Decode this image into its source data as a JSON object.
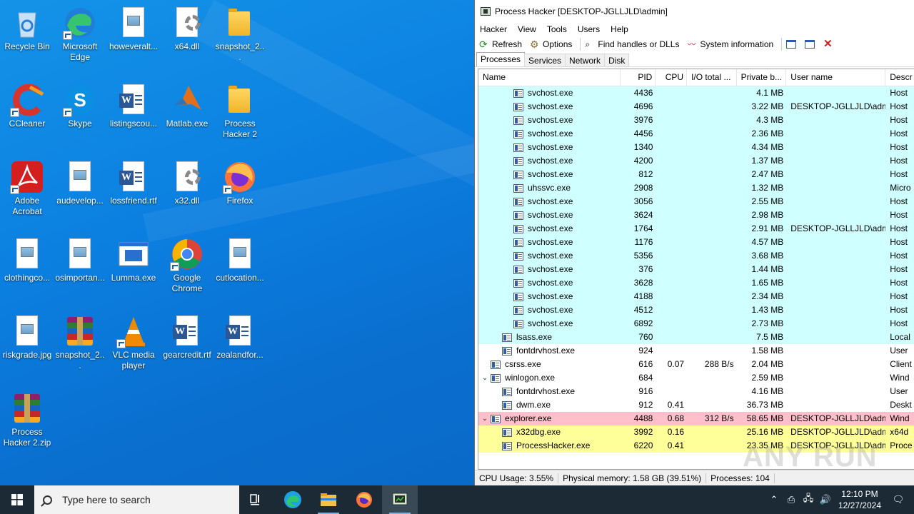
{
  "desktop": {
    "icons": [
      {
        "label": "Recycle Bin",
        "icon": "recycle-bin-icon"
      },
      {
        "label": "Microsoft Edge",
        "icon": "edge-icon"
      },
      {
        "label": "howeveralt...",
        "icon": "image-file-icon"
      },
      {
        "label": "x64.dll",
        "icon": "dll-file-icon"
      },
      {
        "label": "snapshot_2...",
        "icon": "folder-icon"
      },
      {
        "label": "CCleaner",
        "icon": "ccleaner-icon"
      },
      {
        "label": "Skype",
        "icon": "skype-icon"
      },
      {
        "label": "listingscou...",
        "icon": "word-doc-icon"
      },
      {
        "label": "Matlab.exe",
        "icon": "matlab-icon"
      },
      {
        "label": "Process Hacker 2",
        "icon": "folder-icon"
      },
      {
        "label": "Adobe Acrobat",
        "icon": "acrobat-icon"
      },
      {
        "label": "audevelop...",
        "icon": "image-file-icon"
      },
      {
        "label": "lossfriend.rtf",
        "icon": "word-doc-icon"
      },
      {
        "label": "x32.dll",
        "icon": "dll-file-icon"
      },
      {
        "label": "Firefox",
        "icon": "firefox-icon"
      },
      {
        "label": "clothingco...",
        "icon": "image-file-icon"
      },
      {
        "label": "osimportan...",
        "icon": "image-file-icon"
      },
      {
        "label": "Lumma.exe",
        "icon": "exe-window-icon"
      },
      {
        "label": "Google Chrome",
        "icon": "chrome-icon"
      },
      {
        "label": "cutlocation...",
        "icon": "image-file-icon"
      },
      {
        "label": "riskgrade.jpg",
        "icon": "image-file-icon"
      },
      {
        "label": "snapshot_2...",
        "icon": "winrar-icon"
      },
      {
        "label": "VLC media player",
        "icon": "vlc-icon"
      },
      {
        "label": "gearcredit.rtf",
        "icon": "word-doc-icon"
      },
      {
        "label": "zealandfor...",
        "icon": "word-doc-icon"
      },
      {
        "label": "Process Hacker 2.zip",
        "icon": "winrar-icon"
      }
    ]
  },
  "process_hacker": {
    "title": "Process Hacker [DESKTOP-JGLLJLD\\admin]",
    "menu": [
      "Hacker",
      "View",
      "Tools",
      "Users",
      "Help"
    ],
    "toolbar": {
      "refresh": "Refresh",
      "options": "Options",
      "find": "Find handles or DLLs",
      "sysinfo": "System information"
    },
    "tabs": [
      "Processes",
      "Services",
      "Network",
      "Disk"
    ],
    "columns": [
      "Name",
      "PID",
      "CPU",
      "I/O total ...",
      "Private b...",
      "User name",
      "Descr"
    ],
    "rows": [
      {
        "name": "svchost.exe",
        "pid": "4436",
        "cpu": "",
        "io": "",
        "priv": "4.1 MB",
        "user": "",
        "desc": "Host",
        "indent": 3,
        "bg": "#d0ffff",
        "exp": ""
      },
      {
        "name": "svchost.exe",
        "pid": "4696",
        "cpu": "",
        "io": "",
        "priv": "3.22 MB",
        "user": "DESKTOP-JGLLJLD\\admi",
        "desc": "Host",
        "indent": 3,
        "bg": "#d0ffff",
        "exp": ""
      },
      {
        "name": "svchost.exe",
        "pid": "3976",
        "cpu": "",
        "io": "",
        "priv": "4.3 MB",
        "user": "",
        "desc": "Host",
        "indent": 3,
        "bg": "#d0ffff",
        "exp": ""
      },
      {
        "name": "svchost.exe",
        "pid": "4456",
        "cpu": "",
        "io": "",
        "priv": "2.36 MB",
        "user": "",
        "desc": "Host",
        "indent": 3,
        "bg": "#d0ffff",
        "exp": ""
      },
      {
        "name": "svchost.exe",
        "pid": "1340",
        "cpu": "",
        "io": "",
        "priv": "4.34 MB",
        "user": "",
        "desc": "Host",
        "indent": 3,
        "bg": "#d0ffff",
        "exp": ""
      },
      {
        "name": "svchost.exe",
        "pid": "4200",
        "cpu": "",
        "io": "",
        "priv": "1.37 MB",
        "user": "",
        "desc": "Host",
        "indent": 3,
        "bg": "#d0ffff",
        "exp": ""
      },
      {
        "name": "svchost.exe",
        "pid": "812",
        "cpu": "",
        "io": "",
        "priv": "2.47 MB",
        "user": "",
        "desc": "Host",
        "indent": 3,
        "bg": "#d0ffff",
        "exp": ""
      },
      {
        "name": "uhssvc.exe",
        "pid": "2908",
        "cpu": "",
        "io": "",
        "priv": "1.32 MB",
        "user": "",
        "desc": "Micro",
        "indent": 3,
        "bg": "#d0ffff",
        "exp": ""
      },
      {
        "name": "svchost.exe",
        "pid": "3056",
        "cpu": "",
        "io": "",
        "priv": "2.55 MB",
        "user": "",
        "desc": "Host",
        "indent": 3,
        "bg": "#d0ffff",
        "exp": ""
      },
      {
        "name": "svchost.exe",
        "pid": "3624",
        "cpu": "",
        "io": "",
        "priv": "2.98 MB",
        "user": "",
        "desc": "Host",
        "indent": 3,
        "bg": "#d0ffff",
        "exp": ""
      },
      {
        "name": "svchost.exe",
        "pid": "1764",
        "cpu": "",
        "io": "",
        "priv": "2.91 MB",
        "user": "DESKTOP-JGLLJLD\\admi",
        "desc": "Host",
        "indent": 3,
        "bg": "#d0ffff",
        "exp": ""
      },
      {
        "name": "svchost.exe",
        "pid": "1176",
        "cpu": "",
        "io": "",
        "priv": "4.57 MB",
        "user": "",
        "desc": "Host",
        "indent": 3,
        "bg": "#d0ffff",
        "exp": ""
      },
      {
        "name": "svchost.exe",
        "pid": "5356",
        "cpu": "",
        "io": "",
        "priv": "3.68 MB",
        "user": "",
        "desc": "Host",
        "indent": 3,
        "bg": "#d0ffff",
        "exp": ""
      },
      {
        "name": "svchost.exe",
        "pid": "376",
        "cpu": "",
        "io": "",
        "priv": "1.44 MB",
        "user": "",
        "desc": "Host",
        "indent": 3,
        "bg": "#d0ffff",
        "exp": ""
      },
      {
        "name": "svchost.exe",
        "pid": "3628",
        "cpu": "",
        "io": "",
        "priv": "1.65 MB",
        "user": "",
        "desc": "Host",
        "indent": 3,
        "bg": "#d0ffff",
        "exp": ""
      },
      {
        "name": "svchost.exe",
        "pid": "4188",
        "cpu": "",
        "io": "",
        "priv": "2.34 MB",
        "user": "",
        "desc": "Host",
        "indent": 3,
        "bg": "#d0ffff",
        "exp": ""
      },
      {
        "name": "svchost.exe",
        "pid": "4512",
        "cpu": "",
        "io": "",
        "priv": "1.43 MB",
        "user": "",
        "desc": "Host",
        "indent": 3,
        "bg": "#d0ffff",
        "exp": ""
      },
      {
        "name": "svchost.exe",
        "pid": "6892",
        "cpu": "",
        "io": "",
        "priv": "2.73 MB",
        "user": "",
        "desc": "Host",
        "indent": 3,
        "bg": "#d0ffff",
        "exp": ""
      },
      {
        "name": "lsass.exe",
        "pid": "760",
        "cpu": "",
        "io": "",
        "priv": "7.5 MB",
        "user": "",
        "desc": "Local",
        "indent": 2,
        "bg": "#d0ffff",
        "exp": ""
      },
      {
        "name": "fontdrvhost.exe",
        "pid": "924",
        "cpu": "",
        "io": "",
        "priv": "1.58 MB",
        "user": "",
        "desc": "User",
        "indent": 2,
        "bg": "#ffffff",
        "exp": ""
      },
      {
        "name": "csrss.exe",
        "pid": "616",
        "cpu": "0.07",
        "io": "288 B/s",
        "priv": "2.04 MB",
        "user": "",
        "desc": "Client",
        "indent": 1,
        "bg": "#ffffff",
        "exp": ""
      },
      {
        "name": "winlogon.exe",
        "pid": "684",
        "cpu": "",
        "io": "",
        "priv": "2.59 MB",
        "user": "",
        "desc": "Wind",
        "indent": 1,
        "bg": "#ffffff",
        "exp": "v"
      },
      {
        "name": "fontdrvhost.exe",
        "pid": "916",
        "cpu": "",
        "io": "",
        "priv": "4.16 MB",
        "user": "",
        "desc": "User",
        "indent": 2,
        "bg": "#ffffff",
        "exp": ""
      },
      {
        "name": "dwm.exe",
        "pid": "912",
        "cpu": "0.41",
        "io": "",
        "priv": "36.73 MB",
        "user": "",
        "desc": "Deskt",
        "indent": 2,
        "bg": "#ffffff",
        "exp": ""
      },
      {
        "name": "explorer.exe",
        "pid": "4488",
        "cpu": "0.68",
        "io": "312 B/s",
        "priv": "58.65 MB",
        "user": "DESKTOP-JGLLJLD\\admi",
        "desc": "Wind",
        "indent": 1,
        "bg": "#ffc0cb",
        "exp": "v"
      },
      {
        "name": "x32dbg.exe",
        "pid": "3992",
        "cpu": "0.16",
        "io": "",
        "priv": "25.16 MB",
        "user": "DESKTOP-JGLLJLD\\admi",
        "desc": "x64d",
        "indent": 2,
        "bg": "#ffff99",
        "exp": ""
      },
      {
        "name": "ProcessHacker.exe",
        "pid": "6220",
        "cpu": "0.41",
        "io": "",
        "priv": "23.35 MB",
        "user": "DESKTOP-JGLLJLD\\admi",
        "desc": "Proce",
        "indent": 2,
        "bg": "#ffff99",
        "exp": ""
      }
    ],
    "status": {
      "cpu": "CPU Usage: 3.55%",
      "memory": "Physical memory: 1.58 GB (39.51%)",
      "processes": "Processes: 104"
    }
  },
  "watermark": "ANY RUN",
  "taskbar": {
    "search_placeholder": "Type here to search",
    "time": "12:10 PM",
    "date": "12/27/2024"
  }
}
